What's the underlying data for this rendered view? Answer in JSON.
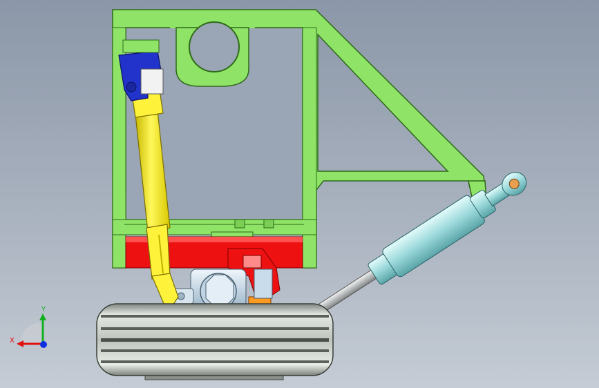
{
  "triad": {
    "x_label": "X",
    "y_label": "Y",
    "x_color": "#e01010",
    "y_color": "#10b020",
    "z_color": "#1030e0"
  },
  "colors": {
    "frame": "#8fe468",
    "frame_stroke": "#2e6a18",
    "crossbar": "#ee1111",
    "strut": "#ffee22",
    "clevis": "#2233cc",
    "cylinder": "#a8e4e6",
    "tire": "#c8cdc8",
    "hub": "#d0e4f2"
  }
}
